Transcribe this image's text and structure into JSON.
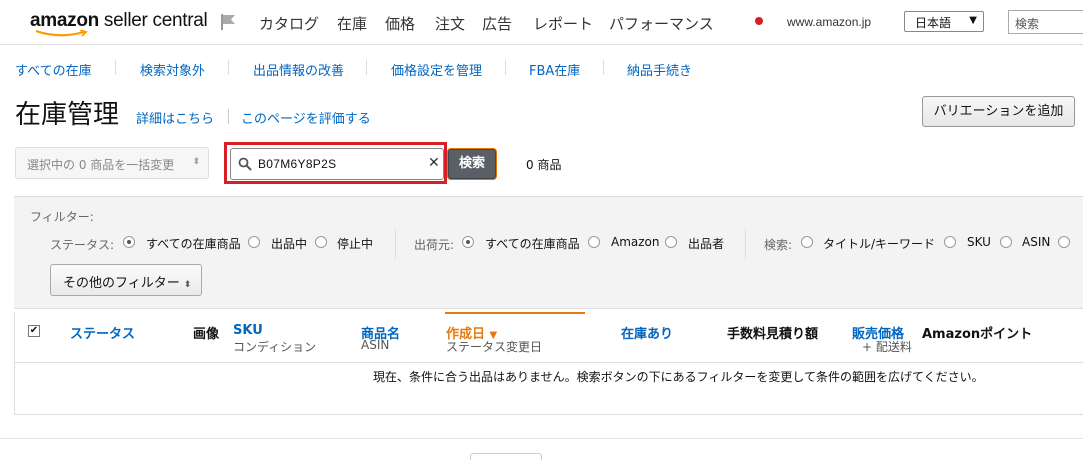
{
  "topnav": {
    "logo_bold": "amazon",
    "logo_rest": " seller central",
    "items": [
      "カタログ",
      "在庫",
      "価格",
      "注文",
      "広告",
      "レポート",
      "パフォーマンス"
    ],
    "domain": "www.amazon.jp",
    "language": "日本語",
    "search_placeholder": "検索"
  },
  "subnav": {
    "items": [
      "すべての在庫",
      "検索対象外",
      "出品情報の改善",
      "価格設定を管理",
      "FBA在庫",
      "納品手続き"
    ]
  },
  "page": {
    "title": "在庫管理",
    "learn_more": "詳細はこちら",
    "rate_page": "このページを評価する",
    "add_variation": "バリエーションを追加"
  },
  "toolbar": {
    "bulk_action": "選択中の 0 商品を一括変更",
    "search_value": "B07M6Y8P2S",
    "search_button": "検索",
    "result_count": "0 商品"
  },
  "filters": {
    "label": "フィルター:",
    "status_label": "ステータス:",
    "status_options": [
      "すべての在庫商品",
      "出品中",
      "停止中"
    ],
    "status_selected": 0,
    "fulfillment_label": "出荷元:",
    "fulfillment_options": [
      "すべての在庫商品",
      "Amazon",
      "出品者"
    ],
    "fulfillment_selected": 0,
    "search_label": "検索:",
    "search_options": [
      "タイトル/キーワード",
      "SKU",
      "ASIN"
    ],
    "more_filters": "その他のフィルター"
  },
  "table": {
    "columns": {
      "status": "ステータス",
      "image": "画像",
      "sku": "SKU",
      "sku_sub": "コンディション",
      "product_name": "商品名",
      "product_sub": "ASIN",
      "created": "作成日",
      "created_sub": "ステータス変更日",
      "in_stock": "在庫あり",
      "fee_estimate": "手数料見積り額",
      "price": "販売価格",
      "price_sub": "+ 配送料",
      "amazon_points": "Amazonポイント"
    },
    "empty_message": "現在、条件に合う出品はありません。検索ボタンの下にあるフィルターを変更して条件の範囲を広げてください。"
  },
  "colors": {
    "link": "#0066c0",
    "highlight_border": "#d61f26",
    "sort_accent": "#e47911",
    "search_button": "#5a5f66"
  }
}
